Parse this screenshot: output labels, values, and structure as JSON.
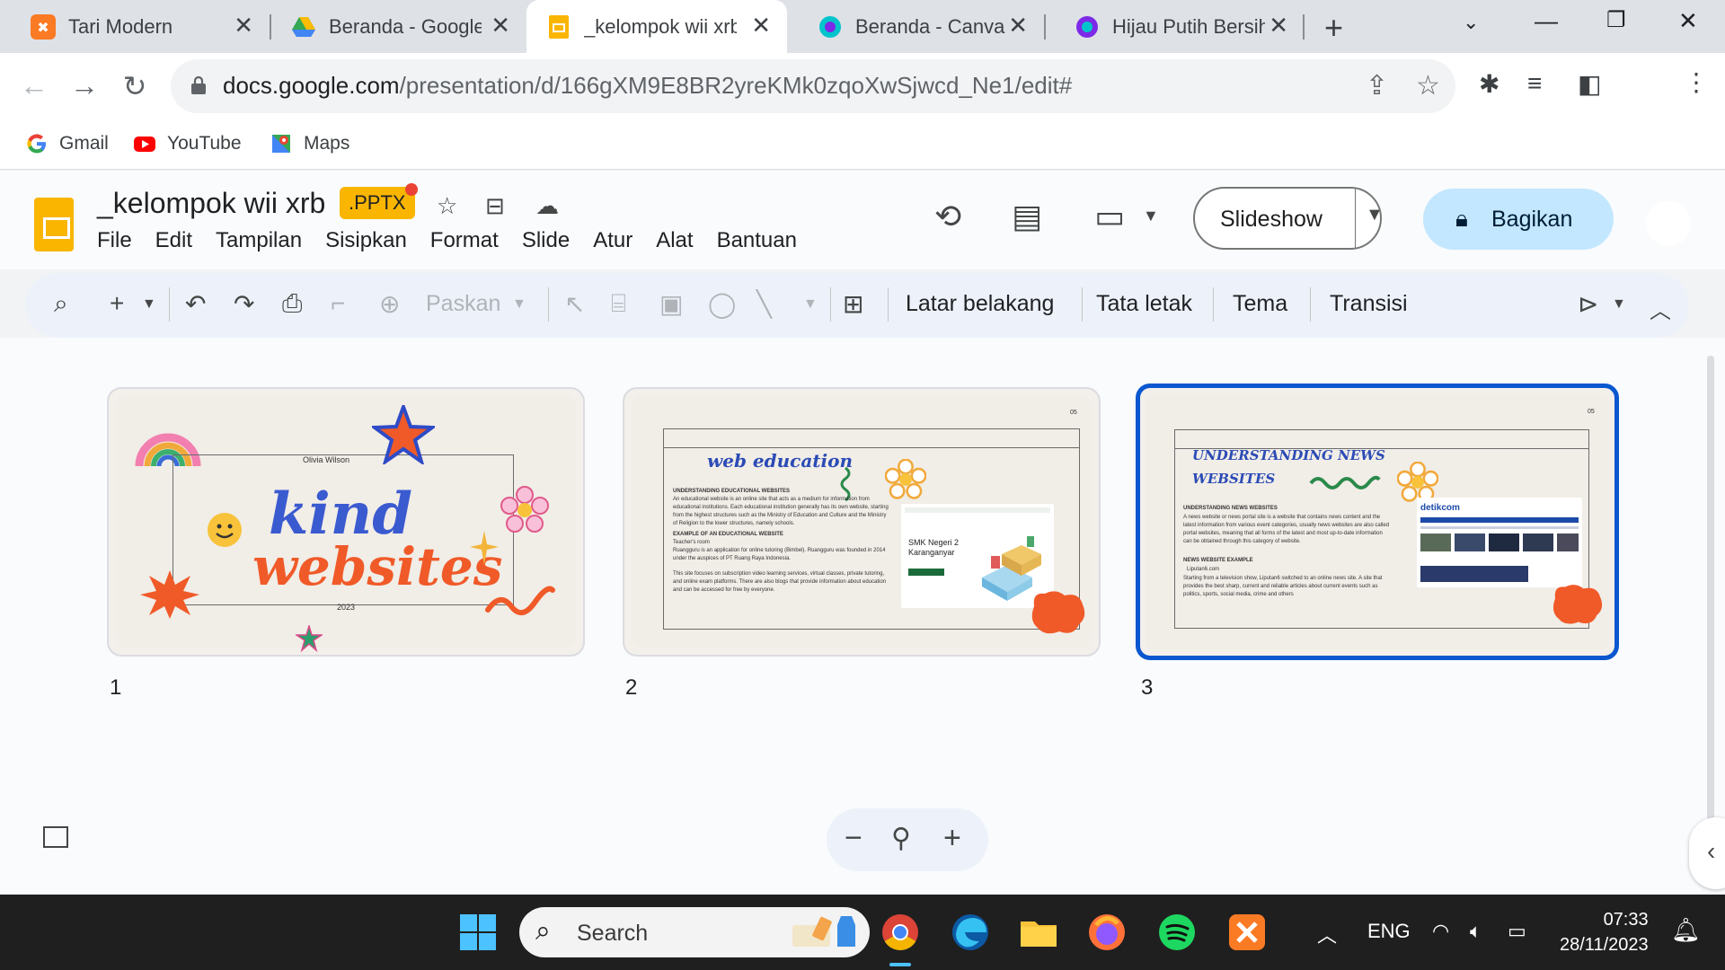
{
  "browser": {
    "tabs": [
      {
        "title": "Tari Modern",
        "favicon": "xampp-icon"
      },
      {
        "title": "Beranda - Google",
        "favicon": "google-drive-icon"
      },
      {
        "title": "_kelompok wii xrb",
        "favicon": "google-slides-icon"
      },
      {
        "title": "Beranda - Canva",
        "favicon": "canva-icon"
      },
      {
        "title": "Hijau Putih Bersih",
        "favicon": "canva-icon"
      }
    ],
    "url_host": "docs.google.com",
    "url_path": "/presentation/d/166gXM9E8BR2yreKMk0zqoXwSjwcd_Ne1/edit#",
    "bookmarks": [
      "Gmail",
      "YouTube",
      "Maps"
    ]
  },
  "slides_app": {
    "doc_title": "_kelompok wii xrb",
    "badge": ".PPTX",
    "menu": [
      "File",
      "Edit",
      "Tampilan",
      "Sisipkan",
      "Format",
      "Slide",
      "Atur",
      "Alat",
      "Bantuan"
    ],
    "slideshow_label": "Slideshow",
    "share_label": "Bagikan",
    "toolbar": {
      "zoom_label": "Paskan",
      "background": "Latar belakang",
      "layout": "Tata letak",
      "theme": "Tema",
      "transition": "Transisi"
    }
  },
  "slides": [
    {
      "number": "1",
      "name": "Olivia Wilson",
      "title_line1": "kind",
      "title_line2": "websites",
      "year": "2023"
    },
    {
      "number": "2",
      "page": "05",
      "title": "web education",
      "heading": "UNDERSTANDING EDUCATIONAL WEBSITES",
      "body": "An educational website is an online site that acts as a medium for information from educational institutions. Each educational institution generally has its own website, starting from the highest structures such as the Ministry of Education and Culture and the Ministry of Religion to the lower structures, namely schools.",
      "example_head": "EXAMPLE OF AN EDUCATIONAL WEBSITE",
      "example_name": "Teacher's room",
      "example_body": "Ruangguru is an application for online tutoring (Bimbel). Ruangguru was founded in 2014 under the auspices of PT Ruang Raya Indonesia.",
      "extra": "This site focuses on subscription video learning services, virtual classes, private tutoring, and online exam platforms. There are also blogs that provide information about education and can be accessed for free by everyone.",
      "card_label": "SMK Negeri 2 Karanganyar"
    },
    {
      "number": "3",
      "page": "05",
      "title_line1": "UNDERSTANDING NEWS",
      "title_line2": "WEBSITES",
      "heading": "UNDERSTANDING NEWS WEBSITES",
      "body": "A news website or news portal site is a website that contains news content and the latest information from various event categories, usually news websites are also called portal websites, meaning that all forms of the latest and most up-to-date information can be obtained through this category of website.",
      "example_head": "NEWS WEBSITE EXAMPLE",
      "example_name": "Liputan6.com",
      "example_body": "Starting from a television show, Liputan6 switched to an online news site. A site that provides the best sharp, current and reliable articles about current events such as politics, sports, social media, crime and others",
      "card_label": "detikcom"
    }
  ],
  "taskbar": {
    "search_placeholder": "Search",
    "language": "ENG",
    "time": "07:33",
    "date": "28/11/2023"
  },
  "colors": {
    "accent_blue": "#0b57d0",
    "share_bg": "#c2e7ff",
    "slides_yellow": "#f9b500",
    "title_orange": "#f05a28",
    "title_blue": "#2b4bb5"
  }
}
